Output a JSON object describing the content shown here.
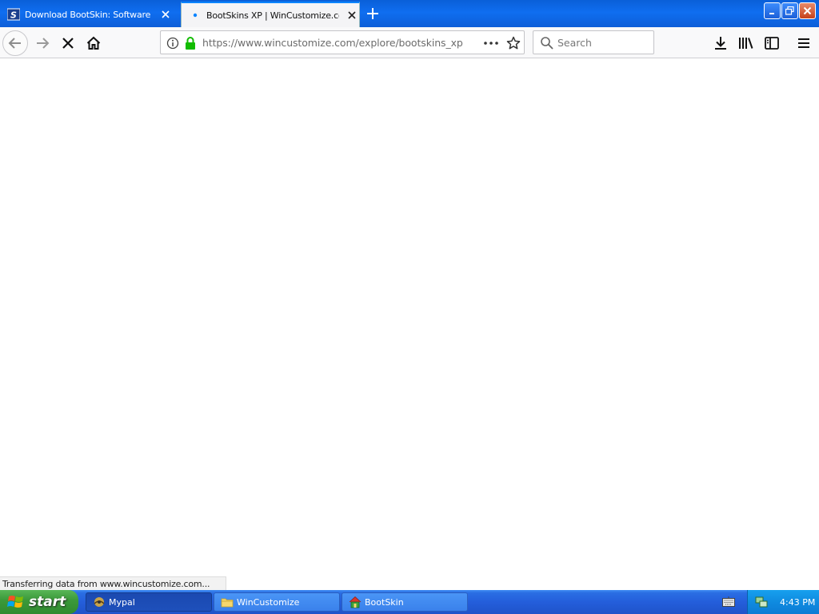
{
  "browser": {
    "tabs": [
      {
        "title": "Download BootSkin: Software from",
        "active": false,
        "icon": "stardock-icon"
      },
      {
        "title": "BootSkins XP | WinCustomize.com",
        "active": true,
        "icon": "loading-dot-icon"
      }
    ],
    "url": "https://www.wincustomize.com/explore/bootskins_xp",
    "search_placeholder": "Search",
    "status_text": "Transferring data from www.wincustomize.com..."
  },
  "taskbar": {
    "start_label": "start",
    "tasks": [
      {
        "label": "Mypal",
        "active": true,
        "icon": "mypal-icon"
      },
      {
        "label": "WinCustomize",
        "active": false,
        "icon": "folder-icon"
      },
      {
        "label": "BootSkin",
        "active": false,
        "icon": "bootskin-icon"
      }
    ],
    "clock": "4:43 PM"
  },
  "colors": {
    "titlebar": "#0f6ef0",
    "taskbar": "#245edb",
    "start_button": "#3c9a3b",
    "tray": "#0f8be0",
    "lock_green": "#12bc00"
  }
}
